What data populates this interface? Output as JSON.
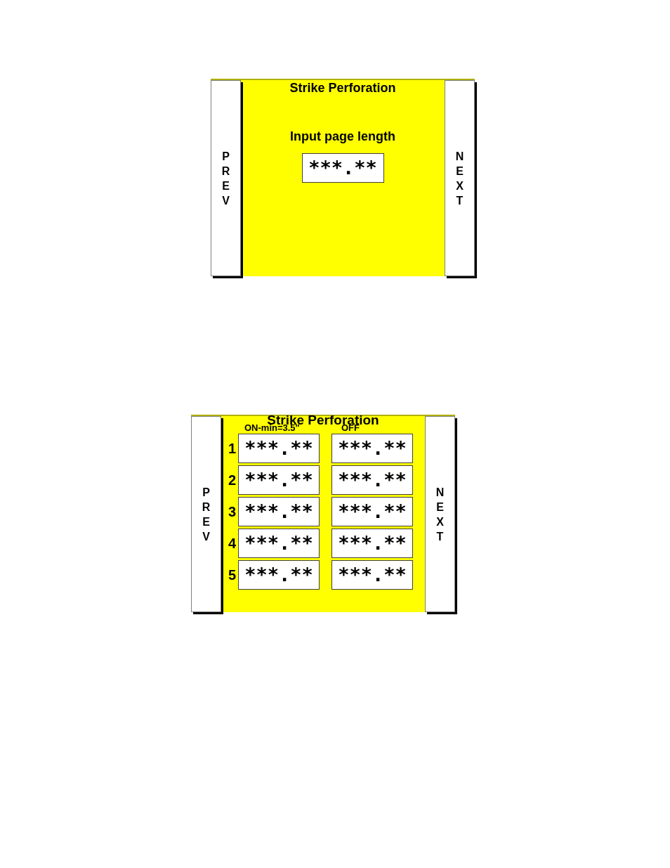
{
  "screens": [
    {
      "kind": "single",
      "title": "Strike Perforation",
      "prev_button": "PREV",
      "next_button": "NEXT",
      "prompt": "Input page length",
      "field": "***.**"
    },
    {
      "kind": "table",
      "title": "Strike Perforation",
      "prev_button": "PREV",
      "next_button": "NEXT",
      "columns": [
        "ON-min=3.5\"",
        "OFF"
      ],
      "rows": [
        {
          "label": "1",
          "on": "***.**",
          "off": "***.**"
        },
        {
          "label": "2",
          "on": "***.**",
          "off": "***.**"
        },
        {
          "label": "3",
          "on": "***.**",
          "off": "***.**"
        },
        {
          "label": "4",
          "on": "***.**",
          "off": "***.**"
        },
        {
          "label": "5",
          "on": "***.**",
          "off": "***.**"
        }
      ]
    }
  ]
}
